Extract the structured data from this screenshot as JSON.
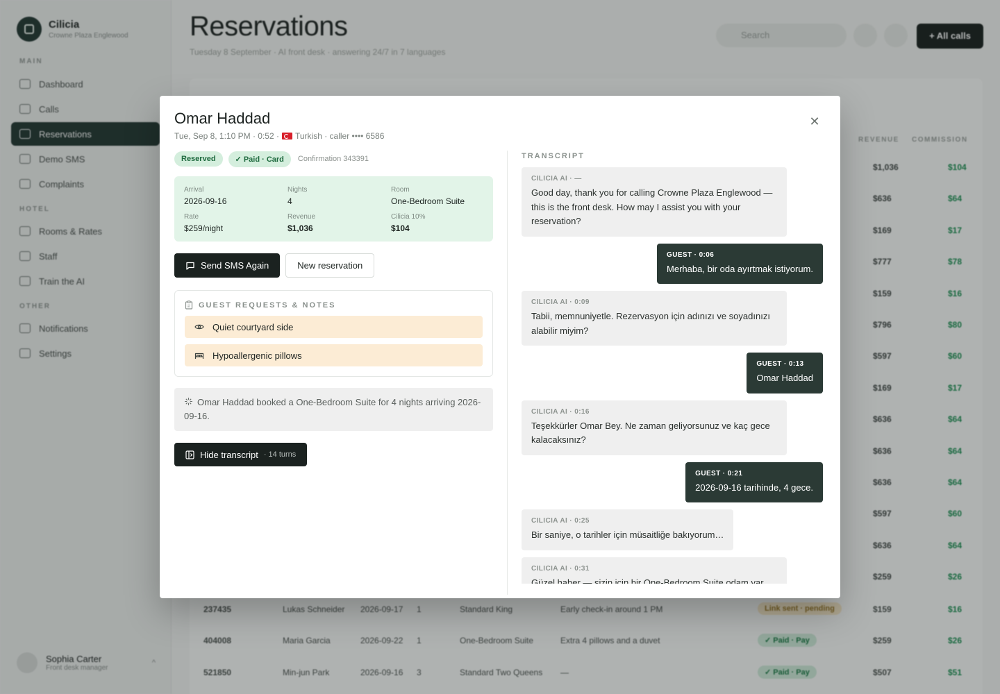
{
  "app": {
    "brand_name": "Cilicia",
    "brand_sub": "Crowne Plaza Englewood",
    "page_title": "Reservations",
    "page_sub": "Tuesday 8 September · AI front desk · answering 24/7 in 7 languages",
    "search_placeholder": "Search",
    "all_calls_label": "All calls",
    "nav_sections": [
      "MAIN",
      "HOTEL",
      "OTHER"
    ],
    "nav": {
      "dashboard": "Dashboard",
      "calls": "Calls",
      "reservations": "Reservations",
      "demo_sms": "Demo SMS",
      "complaints": "Complaints",
      "rooms_rates": "Rooms & Rates",
      "staff": "Staff",
      "train_ai": "Train the AI",
      "notifications": "Notifications",
      "settings": "Settings"
    },
    "user": {
      "name": "Sophia Carter",
      "role": "Front desk manager"
    },
    "table_headers": {
      "revenue": "REVENUE",
      "commission": "COMMISSION"
    },
    "revenue_rows": [
      {
        "rev": "$1,036",
        "com": "$104"
      },
      {
        "rev": "$636",
        "com": "$64"
      },
      {
        "rev": "$169",
        "com": "$17"
      },
      {
        "rev": "$777",
        "com": "$78"
      },
      {
        "rev": "$159",
        "com": "$16"
      },
      {
        "rev": "$796",
        "com": "$80"
      },
      {
        "rev": "$597",
        "com": "$60"
      },
      {
        "rev": "$169",
        "com": "$17"
      },
      {
        "rev": "$636",
        "com": "$64"
      },
      {
        "rev": "$636",
        "com": "$64"
      },
      {
        "rev": "$636",
        "com": "$64"
      },
      {
        "rev": "$597",
        "com": "$60"
      },
      {
        "rev": "$636",
        "com": "$64"
      },
      {
        "rev": "$259",
        "com": "$26"
      }
    ],
    "bottom_rows": [
      {
        "id": "237435",
        "name": "Lukas Schneider",
        "date": "2026-09-17",
        "n": "1",
        "room": "Standard King",
        "note": "Early check-in around 1 PM",
        "status": "Link sent · pending",
        "rev": "$159",
        "com": "$16"
      },
      {
        "id": "404008",
        "name": "Maria Garcia",
        "date": "2026-09-22",
        "n": "1",
        "room": "One-Bedroom Suite",
        "note": "Extra 4 pillows and a duvet",
        "status": "✓ Paid · Pay",
        "rev": "$259",
        "com": "$26"
      },
      {
        "id": "521850",
        "name": "Min-jun Park",
        "date": "2026-09-16",
        "n": "3",
        "room": "Standard Two Queens",
        "note": "—",
        "status": "✓ Paid · Pay",
        "rev": "$507",
        "com": "$51"
      }
    ]
  },
  "modal": {
    "guest_name": "Omar Haddad",
    "meta_left": "Tue, Sep 8, 1:10 PM · 0:52 ·",
    "meta_right": "Turkish · caller •••• 6586",
    "badge_status": "Reserved",
    "badge_paid": "✓ Paid · Card",
    "confirmation": "Confirmation 343391",
    "details": {
      "arrival_label": "Arrival",
      "arrival": "2026-09-16",
      "nights_label": "Nights",
      "nights": "4",
      "room_label": "Room",
      "room": "One-Bedroom Suite",
      "rate_label": "Rate",
      "rate": "$259/night",
      "revenue_label": "Revenue",
      "revenue": "$1,036",
      "commission_label": "Cilicia 10%",
      "commission": "$104"
    },
    "send_sms_label": "Send SMS Again",
    "new_reservation_label": "New reservation",
    "notes_header": "GUEST REQUESTS & NOTES",
    "notes": [
      "Quiet courtyard side",
      "Hypoallergenic pillows"
    ],
    "summary": "Omar Haddad booked a One-Bedroom Suite for 4 nights arriving 2026-09-16.",
    "hide_transcript_label": "Hide transcript",
    "turns": "· 14 turns",
    "transcript_header": "TRANSCRIPT",
    "transcript": [
      {
        "who": "CILICIA AI · —",
        "text": "Good day, thank you for calling Crowne Plaza Englewood — this is the front desk. How may I assist you with your reservation?"
      },
      {
        "who": "GUEST · 0:06",
        "text": "Merhaba, bir oda ayırtmak istiyorum."
      },
      {
        "who": "CILICIA AI · 0:09",
        "text": "Tabii, memnuniyetle. Rezervasyon için adınızı ve soyadınızı alabilir miyim?"
      },
      {
        "who": "GUEST · 0:13",
        "text": "Omar Haddad"
      },
      {
        "who": "CILICIA AI · 0:16",
        "text": "Teşekkürler Omar Bey. Ne zaman geliyorsunuz ve kaç gece kalacaksınız?"
      },
      {
        "who": "GUEST · 0:21",
        "text": "2026-09-16 tarihinde, 4 gece."
      },
      {
        "who": "CILICIA AI · 0:25",
        "text": "Bir saniye, o tarihler için müsaitliğe bakıyorum…"
      },
      {
        "who": "CILICIA AI · 0:31",
        "text": "Güzel haber — sizin için bir One-Bedroom Suite odam var."
      }
    ]
  }
}
